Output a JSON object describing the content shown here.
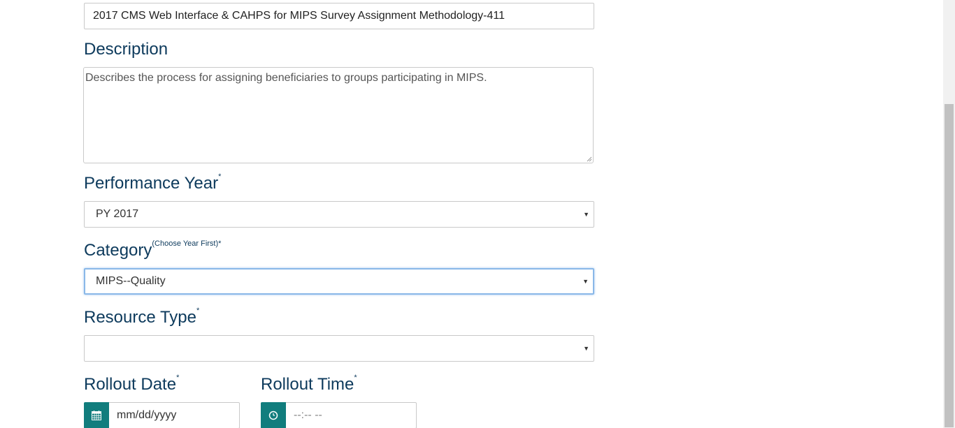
{
  "title_field": {
    "value": "2017 CMS Web Interface & CAHPS for MIPS Survey Assignment Methodology-411"
  },
  "description": {
    "label": "Description",
    "value": "Describes the process for assigning beneficiaries to groups participating in MIPS."
  },
  "performance_year": {
    "label": "Performance Year",
    "required_mark": "*",
    "selected": "PY 2017"
  },
  "category": {
    "label": "Category",
    "hint": "(Choose Year First)*",
    "selected": "MIPS--Quality"
  },
  "resource_type": {
    "label": "Resource Type",
    "required_mark": "*",
    "selected": ""
  },
  "rollout_date": {
    "label": "Rollout Date",
    "required_mark": "*",
    "placeholder": "mm/dd/yyyy",
    "icon": "calendar-icon"
  },
  "rollout_time": {
    "label": "Rollout Time",
    "required_mark": "*",
    "placeholder": "--:-- --",
    "icon": "clock-icon"
  },
  "colors": {
    "label": "#0d3a5c",
    "addon": "#117d7d",
    "focus_border": "#8ab8e8"
  }
}
